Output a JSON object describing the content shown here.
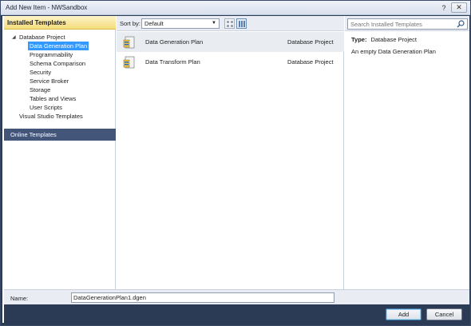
{
  "window": {
    "title": "Add New Item - NWSandbox",
    "help": "?",
    "close": "✕"
  },
  "left": {
    "installed_header": "Installed Templates",
    "tree": [
      {
        "label": "Database Project",
        "level": 0,
        "selected": false
      },
      {
        "label": "Data Generation Plan",
        "level": 1,
        "selected": true
      },
      {
        "label": "Programmability",
        "level": 1,
        "selected": false
      },
      {
        "label": "Schema Comparison",
        "level": 1,
        "selected": false
      },
      {
        "label": "Security",
        "level": 1,
        "selected": false
      },
      {
        "label": "Service Broker",
        "level": 1,
        "selected": false
      },
      {
        "label": "Storage",
        "level": 1,
        "selected": false
      },
      {
        "label": "Tables and Views",
        "level": 1,
        "selected": false
      },
      {
        "label": "User Scripts",
        "level": 1,
        "selected": false
      },
      {
        "label": "Visual Studio Templates",
        "level": 0,
        "selected": false
      }
    ],
    "online_templates": "Online Templates"
  },
  "toolbar": {
    "sort_label": "Sort by:",
    "sort_value": "Default"
  },
  "search": {
    "placeholder": "Search Installed Templates"
  },
  "templates": [
    {
      "name": "Data Generation Plan",
      "type": "Database Project",
      "selected": true
    },
    {
      "name": "Data Transform Plan",
      "type": "Database Project",
      "selected": false
    }
  ],
  "details": {
    "type_label": "Type:",
    "type_value": "Database Project",
    "description": "An empty Data Generation Plan"
  },
  "name_row": {
    "label": "Name:",
    "value": "DataGenerationPlan1.dgen"
  },
  "buttons": {
    "add": "Add",
    "cancel": "Cancel"
  }
}
